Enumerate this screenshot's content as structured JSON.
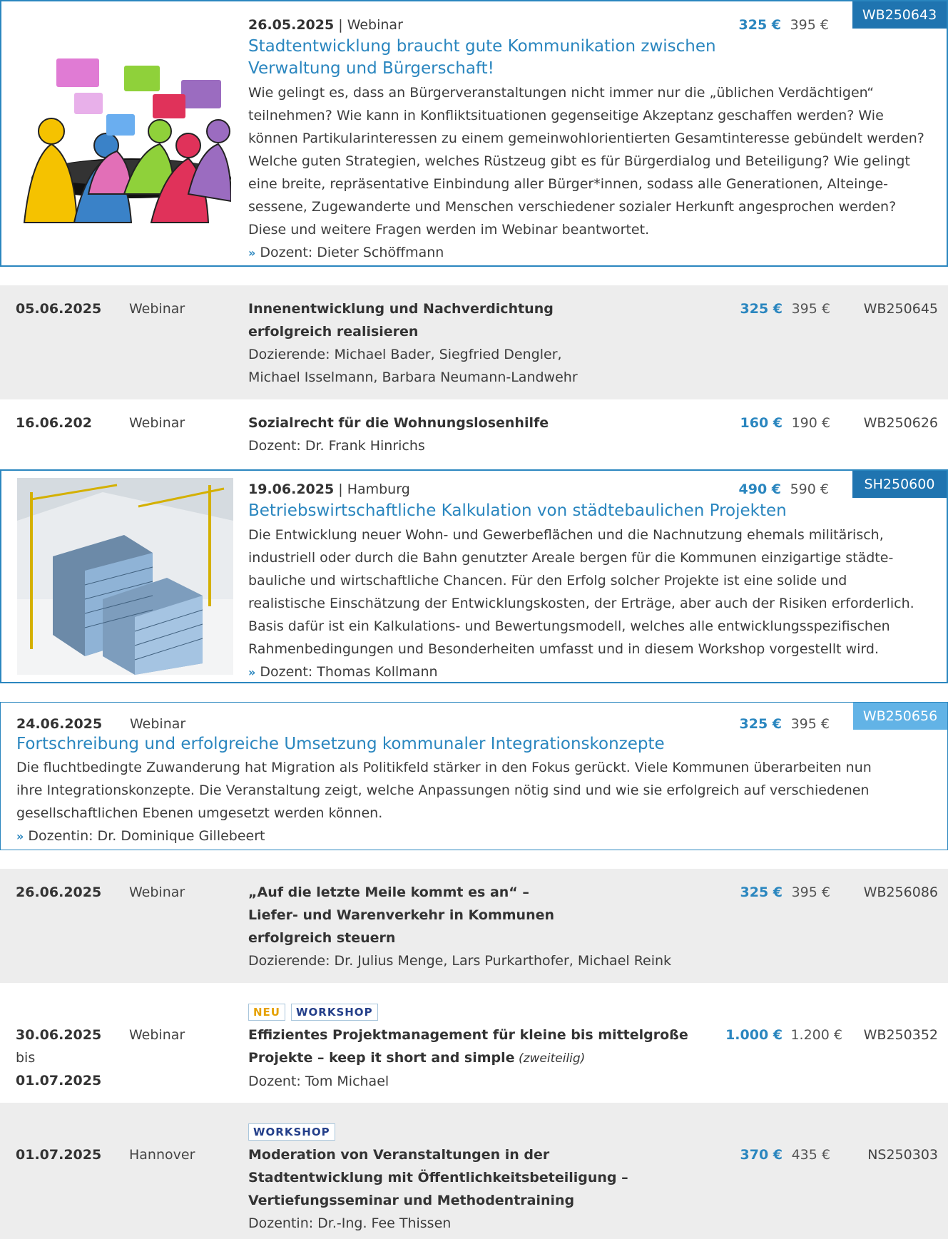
{
  "events": [
    {
      "date": "26.05.2025",
      "sep": " | ",
      "type": "Webinar",
      "title_line1": "Stadtentwicklung braucht gute Kommunikation zwischen",
      "title_line2": "Verwaltung und Bürgerschaft!",
      "desc": [
        "Wie gelingt es, dass an Bürgerveranstaltungen nicht immer nur die „üblichen Verdächtigen“",
        "teilnehmen? Wie kann in Konfliktsituationen gegenseitige Akzeptanz geschaffen werden? Wie",
        "können Partikularinteressen zu einem gemeinwohlorientierten Gesamtinteresse gebündelt werden?",
        "Welche guten Strategien, welches Rüstzeug gibt es für Bürgerdialog und Beteiligung? Wie gelingt",
        "eine breite, repräsentative Einbindung aller Bürger*innen, sodass alle Generationen, Alteinge-",
        "sessene, Zugewanderte und Menschen verschiedener sozialer Herkunft angesprochen werden?",
        "Diese und weitere Fragen werden im Webinar beantwortet."
      ],
      "speaker": "Dozent: Dieter Schöffmann",
      "price": "325 €",
      "old_price": "395 €",
      "code": "WB250643"
    },
    {
      "date": "05.06.2025",
      "type": "Webinar",
      "title_line1": "Innenentwicklung und Nachverdichtung",
      "title_line2": "erfolgreich realisieren",
      "speaker_line1": "Dozierende: Michael Bader, Siegfried Dengler,",
      "speaker_line2": "Michael Isselmann, Barbara Neumann-Landwehr",
      "price": "325 €",
      "old_price": "395 €",
      "code": "WB250645"
    },
    {
      "date": "16.06.202",
      "type": "Webinar",
      "title_line1": "Sozialrecht für die Wohnungslosenhilfe",
      "speaker_line1": "Dozent: Dr. Frank Hinrichs",
      "price": "160 €",
      "old_price": "190 €",
      "code": "WB250626"
    },
    {
      "date": "19.06.2025",
      "sep": " | ",
      "type": "Hamburg",
      "title_line1": "Betriebswirtschaftliche Kalkulation von städtebaulichen Projekten",
      "desc": [
        "Die Entwicklung neuer Wohn- und Gewerbeflächen und die Nachnutzung ehemals militärisch,",
        "industriell oder durch die Bahn genutzter Areale bergen für die Kommunen einzigartige städte-",
        "bauliche und wirtschaftliche Chancen. Für den Erfolg solcher Projekte ist eine solide und",
        "realistische Einschätzung der Entwicklungskosten, der Erträge, aber auch der Risiken erforderlich.",
        "Basis dafür ist ein Kalkulations- und Bewertungsmodell, welches alle entwicklungsspezifischen",
        "Rahmenbedingungen und Besonderheiten umfasst und in diesem Workshop vorgestellt wird."
      ],
      "speaker": "Dozent: Thomas Kollmann",
      "price": "490 €",
      "old_price": "590 €",
      "code": "SH250600"
    },
    {
      "date": "24.06.2025",
      "type": "Webinar",
      "title_line1": "Fortschreibung und erfolgreiche Umsetzung kommunaler Integrationskonzepte",
      "desc": [
        "Die fluchtbedingte Zuwanderung hat Migration als Politikfeld stärker in den Fokus gerückt. Viele Kommunen überarbeiten nun",
        "ihre Integrationskonzepte. Die Veranstaltung zeigt, welche Anpassungen nötig sind und wie sie erfolgreich auf verschiedenen",
        "gesellschaftlichen Ebenen umgesetzt werden können."
      ],
      "speaker": "Dozentin: Dr. Dominique Gillebeert",
      "price": "325 €",
      "old_price": "395 €",
      "code": "WB250656"
    },
    {
      "date": "26.06.2025",
      "type": "Webinar",
      "title_line1": "„Auf die letzte Meile kommt es an“ –",
      "title_line2": "Liefer- und Warenverkehr in Kommunen",
      "title_line3": "erfolgreich steuern",
      "speaker_line1": "Dozierende: Dr. Julius Menge, Lars Purkarthofer, Michael Reink",
      "price": "325 €",
      "old_price": "395 €",
      "code": "WB256086"
    },
    {
      "tag_new": "NEU",
      "tag_ws": "WORKSHOP",
      "date": "30.06.2025",
      "date_mid": "bis",
      "date_end": "01.07.2025",
      "type": "Webinar",
      "title_line1": "Effizientes Projektmanagement für kleine bis mittelgroße",
      "title_line2": "Projekte – keep it short and simple",
      "title_suffix": " (zweiteilig)",
      "speaker_line1": "Dozent: Tom Michael",
      "price": "1.000 €",
      "old_price": "1.200 €",
      "code": "WB250352"
    },
    {
      "tag_ws": "WORKSHOP",
      "date": "01.07.2025",
      "type": "Hannover",
      "title_line1": "Moderation von Veranstaltungen in der",
      "title_line2": "Stadtentwicklung mit Öffentlichkeitsbeteiligung –",
      "title_line3": "Vertiefungsseminar und Methodentraining",
      "speaker_line1": "Dozentin: Dr.-Ing. Fee Thissen",
      "price": "370 €",
      "old_price": "435 €",
      "code": "NS250303"
    }
  ]
}
